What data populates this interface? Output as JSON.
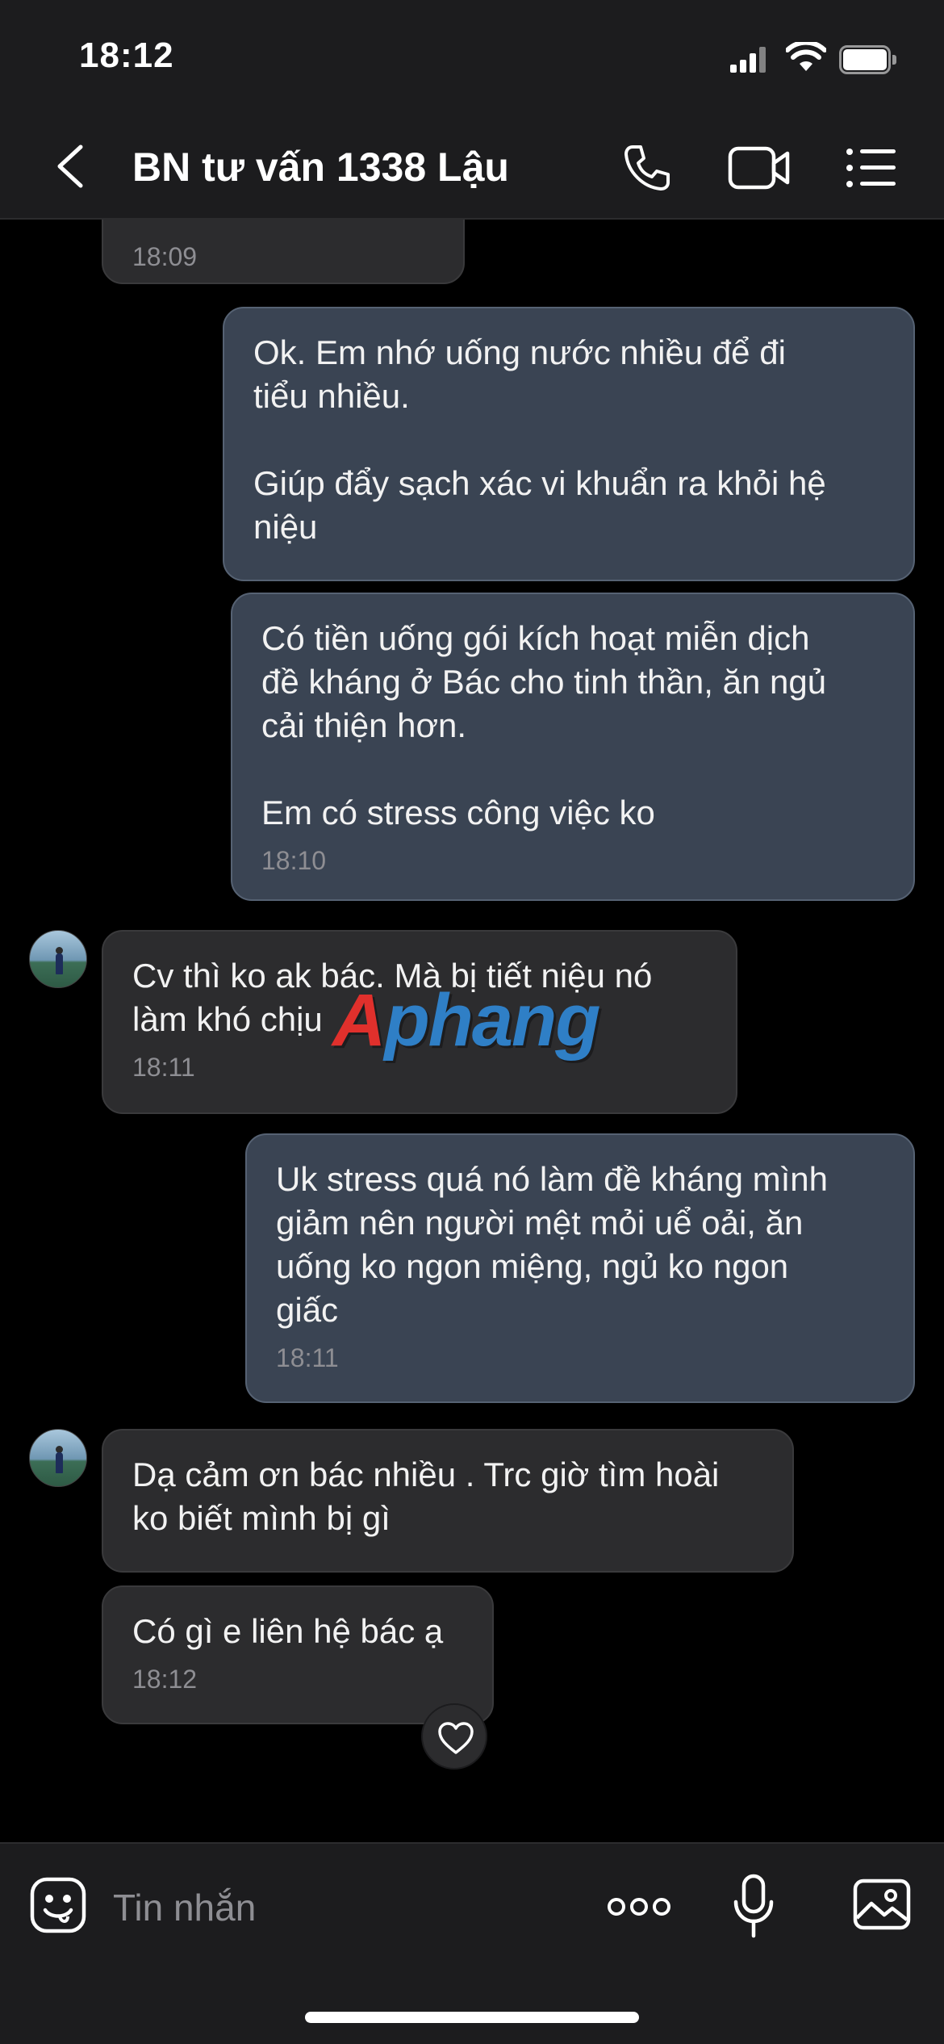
{
  "status_bar": {
    "time": "18:12"
  },
  "header": {
    "title": "BN tư vấn 1338 Lậu",
    "icons": [
      "back-icon",
      "call-icon",
      "video-call-icon",
      "menu-icon"
    ]
  },
  "messages": [
    {
      "direction": "in",
      "text": "",
      "time": "18:09"
    },
    {
      "direction": "out",
      "text": "Ok. Em nhớ uống nước nhiều để đi\ntiểu nhiều.\n\nGiúp đẩy sạch xác vi khuẩn ra khỏi hệ\nniệu",
      "time": ""
    },
    {
      "direction": "out",
      "text": "Có tiền uống gói kích hoạt miễn dịch\nđề kháng ở Bác cho tinh thần, ăn ngủ\ncải thiện hơn.\n\nEm có stress công việc ko",
      "time": "18:10"
    },
    {
      "direction": "in",
      "text": "Cv thì ko ak bác. Mà bị tiết niệu nó\nlàm khó chịu",
      "time": "18:11"
    },
    {
      "direction": "out",
      "text": "Uk stress quá nó làm đề kháng mình\ngiảm nên người mệt mỏi uể oải, ăn\nuống ko ngon miệng, ngủ ko ngon\ngiấc",
      "time": "18:11"
    },
    {
      "direction": "in",
      "text": "Dạ cảm ơn bác nhiều . Trc giờ tìm hoài\nko biết mình bị gì",
      "time": ""
    },
    {
      "direction": "in",
      "text": "Có gì e liên hệ bác ạ",
      "time": "18:12",
      "reaction": "heart-icon"
    }
  ],
  "watermark": {
    "first": "A",
    "rest": "phang"
  },
  "composer": {
    "placeholder": "Tin nhắn",
    "icons": [
      "emoji-icon",
      "more-icon",
      "microphone-icon",
      "image-icon"
    ]
  },
  "colors": {
    "outgoing_bubble": "#3a4453",
    "incoming_bubble": "#2c2c2e",
    "background": "#000000",
    "bar": "#1c1c1e"
  }
}
